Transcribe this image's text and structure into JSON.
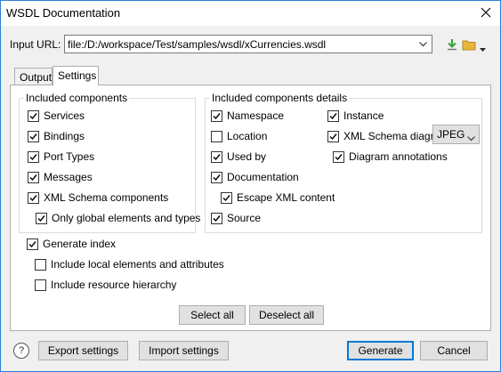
{
  "window": {
    "title": "WSDL Documentation",
    "close_icon": "close-icon"
  },
  "input_url": {
    "label": "Input URL:",
    "value": "file:/D:/workspace/Test/samples/wsdl/xCurrencies.wsdl",
    "icons": [
      "chevron-down-icon",
      "download-arrow-icon",
      "folder-icon",
      "chevron-down-icon"
    ],
    "colors": {
      "download": "#3aa33a",
      "folder": "#e8b83a"
    }
  },
  "tabs": [
    {
      "label": "Output",
      "selected": false
    },
    {
      "label": "Settings",
      "selected": true
    }
  ],
  "included_components": {
    "title": "Included components",
    "items": [
      {
        "label": "Services",
        "checked": true
      },
      {
        "label": "Bindings",
        "checked": true
      },
      {
        "label": "Port Types",
        "checked": true
      },
      {
        "label": "Messages",
        "checked": true
      },
      {
        "label": "XML Schema components",
        "checked": true
      },
      {
        "label": "Only global elements and types",
        "checked": true
      }
    ]
  },
  "included_details": {
    "title": "Included components details",
    "left": [
      {
        "label": "Namespace",
        "checked": true
      },
      {
        "label": "Location",
        "checked": false
      },
      {
        "label": "Used by",
        "checked": true
      },
      {
        "label": "Documentation",
        "checked": true
      },
      {
        "label": "Escape XML content",
        "checked": true
      },
      {
        "label": "Source",
        "checked": true
      }
    ],
    "right": [
      {
        "label": "Instance",
        "checked": true
      },
      {
        "label": "XML Schema diagram",
        "checked": true
      },
      {
        "label": "Diagram annotations",
        "checked": true
      }
    ],
    "diagram_format": "JPEG"
  },
  "index": {
    "generate_index": {
      "label": "Generate index",
      "checked": true
    },
    "local_elements": {
      "label": "Include local elements and attributes",
      "checked": false
    },
    "resource_hierarchy": {
      "label": "Include resource hierarchy",
      "checked": false
    }
  },
  "selection_buttons": {
    "select_all": "Select all",
    "deselect_all": "Deselect all"
  },
  "footer": {
    "help": "?",
    "export": "Export settings",
    "import": "Import settings",
    "generate": "Generate",
    "cancel": "Cancel"
  }
}
